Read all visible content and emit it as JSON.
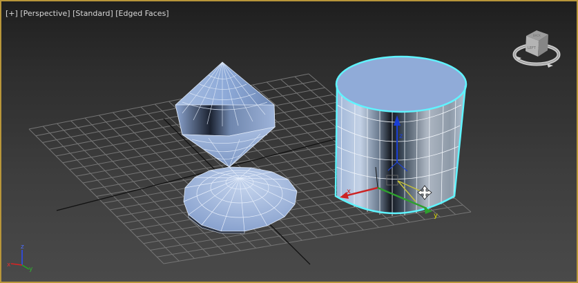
{
  "viewport": {
    "labels": {
      "plus": "[+]",
      "view": "[Perspective]",
      "shading": "[Standard]",
      "mode": "[Edged Faces]"
    },
    "viewcube": {
      "face_label": "LEFT",
      "back_label": "BACK"
    },
    "axes": {
      "x": "x",
      "y": "y",
      "z": "z"
    },
    "gizmo_axes": {
      "x": "x",
      "y": "y",
      "z": "z"
    }
  },
  "scene_objects": [
    {
      "name": "double-cone",
      "type": "Cone"
    },
    {
      "name": "flat-cone-base",
      "type": "Cone"
    },
    {
      "name": "cylinder",
      "type": "Cylinder",
      "selected": true
    }
  ],
  "colors": {
    "viewport_border": "#b8963a",
    "object_face": "#8ea9d8",
    "selection": "#5ff4ff",
    "grid": "#767676"
  }
}
